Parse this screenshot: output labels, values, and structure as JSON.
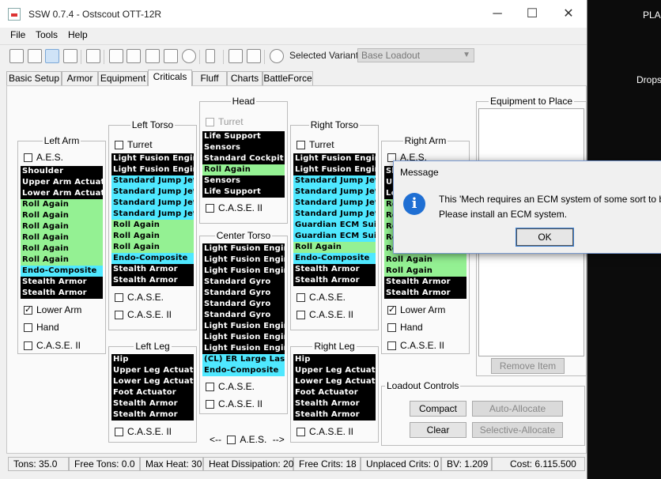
{
  "desktop": {
    "text_top": "PLA",
    "text_mid": "Drops"
  },
  "window": {
    "title": "SSW 0.7.4 - Ostscout OTT-12R",
    "min": "─",
    "max": "☐",
    "close": "✕"
  },
  "menu": [
    "File",
    "Tools",
    "Help"
  ],
  "toolbar": {
    "icons": [
      "new-icon",
      "open-icon",
      "save-icon",
      "print-preview-icon",
      "printer-icon",
      "copy-icon",
      "paste-icon",
      "document-icon",
      "export-icon",
      "chat-icon",
      "battery-icon",
      "clipboard-icon",
      "clipboard-icon",
      "gear-icon"
    ],
    "variant_label": "Selected Variant:",
    "variant_value": "Base Loadout"
  },
  "tabs": [
    "Basic Setup",
    "Armor",
    "Equipment",
    "Criticals",
    "Fluff",
    "Charts",
    "BattleForce"
  ],
  "active_tab": "Criticals",
  "left_arm": {
    "title": "Left Arm",
    "aes": "A.E.S.",
    "slots": [
      {
        "t": "Shoulder",
        "c": "black"
      },
      {
        "t": "Upper Arm Actuator",
        "c": "black"
      },
      {
        "t": "Lower Arm Actuator",
        "c": "black"
      },
      {
        "t": "Roll Again",
        "c": "green"
      },
      {
        "t": "Roll Again",
        "c": "green"
      },
      {
        "t": "Roll Again",
        "c": "green"
      },
      {
        "t": "Roll Again",
        "c": "green"
      },
      {
        "t": "Roll Again",
        "c": "green"
      },
      {
        "t": "Roll Again",
        "c": "green"
      },
      {
        "t": "Endo-Composite",
        "c": "cyan"
      },
      {
        "t": "Stealth Armor",
        "c": "black"
      },
      {
        "t": "Stealth Armor",
        "c": "black"
      }
    ],
    "lower_arm": "Lower Arm",
    "hand": "Hand",
    "case2": "C.A.S.E. II"
  },
  "left_torso": {
    "title": "Left Torso",
    "turret": "Turret",
    "slots": [
      {
        "t": "Light Fusion Engine",
        "c": "black"
      },
      {
        "t": "Light Fusion Engine",
        "c": "black"
      },
      {
        "t": "Standard Jump Jet",
        "c": "cyan"
      },
      {
        "t": "Standard Jump Jet",
        "c": "cyan"
      },
      {
        "t": "Standard Jump Jet",
        "c": "cyan"
      },
      {
        "t": "Standard Jump Jet",
        "c": "cyan"
      },
      {
        "t": "Roll Again",
        "c": "green"
      },
      {
        "t": "Roll Again",
        "c": "green"
      },
      {
        "t": "Roll Again",
        "c": "green"
      },
      {
        "t": "Endo-Composite",
        "c": "cyan"
      },
      {
        "t": "Stealth Armor",
        "c": "black"
      },
      {
        "t": "Stealth Armor",
        "c": "black"
      }
    ],
    "case": "C.A.S.E.",
    "case2": "C.A.S.E. II"
  },
  "head": {
    "title": "Head",
    "turret": "Turret",
    "slots": [
      {
        "t": "Life Support",
        "c": "black"
      },
      {
        "t": "Sensors",
        "c": "black"
      },
      {
        "t": "Standard Cockpit",
        "c": "black"
      },
      {
        "t": "Roll Again",
        "c": "green"
      },
      {
        "t": "Sensors",
        "c": "black"
      },
      {
        "t": "Life Support",
        "c": "black"
      }
    ],
    "case2": "C.A.S.E. II"
  },
  "center_torso": {
    "title": "Center Torso",
    "slots": [
      {
        "t": "Light Fusion Engine",
        "c": "black"
      },
      {
        "t": "Light Fusion Engine",
        "c": "black"
      },
      {
        "t": "Light Fusion Engine",
        "c": "black"
      },
      {
        "t": "Standard Gyro",
        "c": "black"
      },
      {
        "t": "Standard Gyro",
        "c": "black"
      },
      {
        "t": "Standard Gyro",
        "c": "black"
      },
      {
        "t": "Standard Gyro",
        "c": "black"
      },
      {
        "t": "Light Fusion Engine",
        "c": "black"
      },
      {
        "t": "Light Fusion Engine",
        "c": "black"
      },
      {
        "t": "Light Fusion Engine",
        "c": "black"
      },
      {
        "t": "(CL) ER Large Laser",
        "c": "cyan"
      },
      {
        "t": "Endo-Composite",
        "c": "cyan"
      }
    ],
    "case": "C.A.S.E.",
    "case2": "C.A.S.E. II"
  },
  "right_torso": {
    "title": "Right Torso",
    "turret": "Turret",
    "slots": [
      {
        "t": "Light Fusion Engine",
        "c": "black"
      },
      {
        "t": "Light Fusion Engine",
        "c": "black"
      },
      {
        "t": "Standard Jump Jet",
        "c": "cyan"
      },
      {
        "t": "Standard Jump Jet",
        "c": "cyan"
      },
      {
        "t": "Standard Jump Jet",
        "c": "cyan"
      },
      {
        "t": "Standard Jump Jet",
        "c": "cyan"
      },
      {
        "t": "Guardian ECM Suite",
        "c": "cyan"
      },
      {
        "t": "Guardian ECM Suite",
        "c": "cyan"
      },
      {
        "t": "Roll Again",
        "c": "green"
      },
      {
        "t": "Endo-Composite",
        "c": "cyan"
      },
      {
        "t": "Stealth Armor",
        "c": "black"
      },
      {
        "t": "Stealth Armor",
        "c": "black"
      }
    ],
    "case": "C.A.S.E.",
    "case2": "C.A.S.E. II"
  },
  "right_arm": {
    "title": "Right Arm",
    "aes": "A.E.S.",
    "slots": [
      {
        "t": "Sh",
        "c": "black"
      },
      {
        "t": "Up",
        "c": "black"
      },
      {
        "t": "Lo",
        "c": "black"
      },
      {
        "t": "Ro",
        "c": "green"
      },
      {
        "t": "Ro",
        "c": "green"
      },
      {
        "t": "Ro",
        "c": "green"
      },
      {
        "t": "Ro",
        "c": "green"
      },
      {
        "t": "Ro",
        "c": "green"
      },
      {
        "t": "Roll Again",
        "c": "green"
      },
      {
        "t": "Roll Again",
        "c": "green"
      },
      {
        "t": "Stealth Armor",
        "c": "black"
      },
      {
        "t": "Stealth Armor",
        "c": "black"
      }
    ],
    "lower_arm": "Lower Arm",
    "hand": "Hand",
    "case2": "C.A.S.E. II"
  },
  "left_leg": {
    "title": "Left Leg",
    "slots": [
      {
        "t": "Hip",
        "c": "black"
      },
      {
        "t": "Upper Leg Actuator",
        "c": "black"
      },
      {
        "t": "Lower Leg Actuator",
        "c": "black"
      },
      {
        "t": "Foot Actuator",
        "c": "black"
      },
      {
        "t": "Stealth Armor",
        "c": "black"
      },
      {
        "t": "Stealth Armor",
        "c": "black"
      }
    ],
    "case2": "C.A.S.E. II"
  },
  "right_leg": {
    "title": "Right Leg",
    "slots": [
      {
        "t": "Hip",
        "c": "black"
      },
      {
        "t": "Upper Leg Actuator",
        "c": "black"
      },
      {
        "t": "Lower Leg Actuator",
        "c": "black"
      },
      {
        "t": "Foot Actuator",
        "c": "black"
      },
      {
        "t": "Stealth Armor",
        "c": "black"
      },
      {
        "t": "Stealth Armor",
        "c": "black"
      }
    ],
    "case2": "C.A.S.E. II"
  },
  "aes_bottom": {
    "left": "<--",
    "label": "A.E.S.",
    "right": "-->"
  },
  "equipment": {
    "title": "Equipment to Place",
    "remove": "Remove Item"
  },
  "loadout": {
    "title": "Loadout Controls",
    "compact": "Compact",
    "auto": "Auto-Allocate",
    "clear": "Clear",
    "selective": "Selective-Allocate"
  },
  "status": {
    "tons": "Tons: 35.0",
    "free_tons": "Free Tons: 0.0",
    "max_heat": "Max Heat: 30",
    "heat_diss": "Heat Dissipation: 20",
    "free_crits": "Free Crits: 18",
    "unplaced": "Unplaced Crits: 0",
    "bv": "BV: 1.209",
    "cost": "Cost: 6.115.500"
  },
  "dialog": {
    "title": "Message",
    "line1": "This 'Mech requires an ECM system of some sort to be",
    "line2": "Please install an ECM system.",
    "ok": "OK"
  },
  "colors": {
    "slot_cyan": "#4fe8ff",
    "slot_green": "#94f193",
    "slot_black": "#000000",
    "info_blue": "#1f6fd3"
  }
}
